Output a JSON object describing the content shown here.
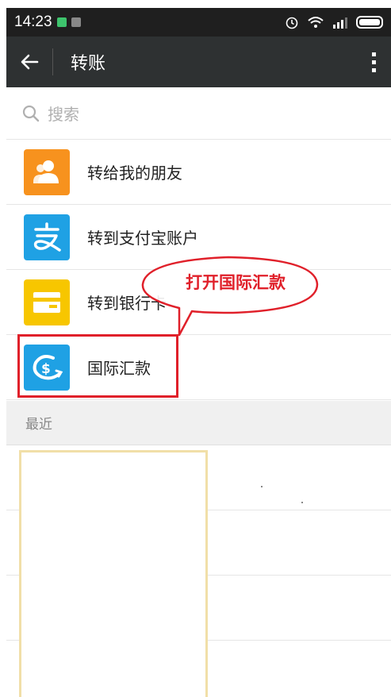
{
  "status_bar": {
    "time": "14:23"
  },
  "app_bar": {
    "title": "转账"
  },
  "search": {
    "placeholder": "搜索"
  },
  "menu": {
    "items": [
      {
        "label": "转给我的朋友",
        "icon": "person-icon",
        "color": "#f7921e"
      },
      {
        "label": "转到支付宝账户",
        "icon": "alipay-icon",
        "color": "#1fa1e4"
      },
      {
        "label": "转到银行卡",
        "icon": "bank-card-icon",
        "color": "#f7c600"
      },
      {
        "label": "国际汇款",
        "icon": "international-remit-icon",
        "color": "#1fa1e4"
      }
    ]
  },
  "recent": {
    "header": "最近"
  },
  "annotation": {
    "callout_text": "打开国际汇款",
    "color": "#e0202a"
  }
}
